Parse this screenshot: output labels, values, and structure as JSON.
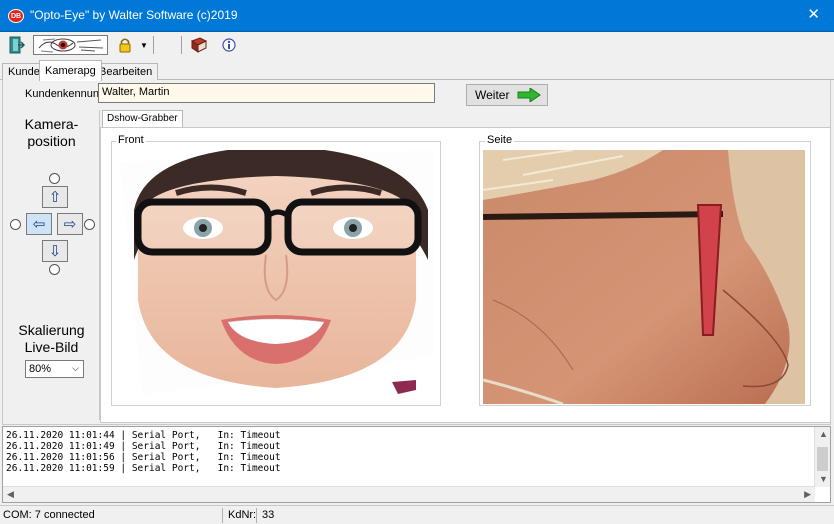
{
  "window": {
    "title": "\"Opto-Eye\" by Walter Software (c)2019",
    "app_badge": "DB",
    "close_label": "✕"
  },
  "toolbar": {
    "icons": [
      "exit-icon",
      "logo-eye",
      "lock-icon",
      "dropdown-arrow",
      "book-icon",
      "info-icon"
    ]
  },
  "tabs": [
    {
      "label": "Kunde"
    },
    {
      "label": "Kamerapg"
    },
    {
      "label": "Bearbeiten"
    }
  ],
  "customer": {
    "label": "Kundenkennung:",
    "value": "Walter, Martin"
  },
  "weiter_button": {
    "label": "Weiter"
  },
  "camera_position": {
    "heading_line1": "Kamera-",
    "heading_line2": "position",
    "up": "⇧",
    "down": "⇩",
    "left": "⇦",
    "right": "⇨"
  },
  "scaling": {
    "heading_line1": "Skalierung",
    "heading_line2": "Live-Bild",
    "selected": "80%"
  },
  "subtab": {
    "label": "Dshow-Grabber"
  },
  "front_label": "Front",
  "side_label": "Seite",
  "log": [
    "26.11.2020 11:01:44 | Serial Port,   In: Timeout",
    "26.11.2020 11:01:49 | Serial Port,   In: Timeout",
    "26.11.2020 11:01:56 | Serial Port,   In: Timeout",
    "26.11.2020 11:01:59 | Serial Port,   In: Timeout"
  ],
  "status": {
    "com": "COM: 7 connected",
    "kdnr_label": "KdNr:",
    "kdnr_value": "33"
  },
  "colors": {
    "titlebar": "#0078d7",
    "input_bg": "#fff9ec",
    "arrow_green": "#2fb82f"
  }
}
